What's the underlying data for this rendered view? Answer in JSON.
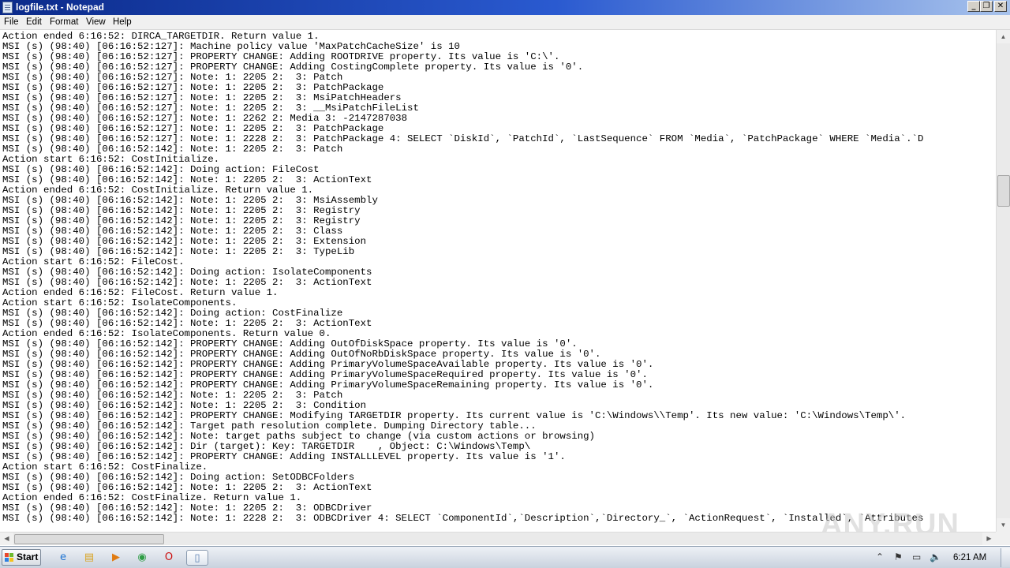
{
  "window": {
    "title": "logfile.txt - Notepad",
    "minimize_glyph": "_",
    "maximize_glyph": "❐",
    "close_glyph": "✕"
  },
  "menu": [
    "File",
    "Edit",
    "Format",
    "View",
    "Help"
  ],
  "lines": [
    "Action ended 6:16:52: DIRCA_TARGETDIR. Return value 1.",
    "MSI (s) (98:40) [06:16:52:127]: Machine policy value 'MaxPatchCacheSize' is 10",
    "MSI (s) (98:40) [06:16:52:127]: PROPERTY CHANGE: Adding ROOTDRIVE property. Its value is 'C:\\'.",
    "MSI (s) (98:40) [06:16:52:127]: PROPERTY CHANGE: Adding CostingComplete property. Its value is '0'.",
    "MSI (s) (98:40) [06:16:52:127]: Note: 1: 2205 2:  3: Patch",
    "MSI (s) (98:40) [06:16:52:127]: Note: 1: 2205 2:  3: PatchPackage",
    "MSI (s) (98:40) [06:16:52:127]: Note: 1: 2205 2:  3: MsiPatchHeaders",
    "MSI (s) (98:40) [06:16:52:127]: Note: 1: 2205 2:  3: __MsiPatchFileList",
    "MSI (s) (98:40) [06:16:52:127]: Note: 1: 2262 2: Media 3: -2147287038",
    "MSI (s) (98:40) [06:16:52:127]: Note: 1: 2205 2:  3: PatchPackage",
    "MSI (s) (98:40) [06:16:52:127]: Note: 1: 2228 2:  3: PatchPackage 4: SELECT `DiskId`, `PatchId`, `LastSequence` FROM `Media`, `PatchPackage` WHERE `Media`.`D",
    "MSI (s) (98:40) [06:16:52:142]: Note: 1: 2205 2:  3: Patch",
    "Action start 6:16:52: CostInitialize.",
    "MSI (s) (98:40) [06:16:52:142]: Doing action: FileCost",
    "MSI (s) (98:40) [06:16:52:142]: Note: 1: 2205 2:  3: ActionText",
    "Action ended 6:16:52: CostInitialize. Return value 1.",
    "MSI (s) (98:40) [06:16:52:142]: Note: 1: 2205 2:  3: MsiAssembly",
    "MSI (s) (98:40) [06:16:52:142]: Note: 1: 2205 2:  3: Registry",
    "MSI (s) (98:40) [06:16:52:142]: Note: 1: 2205 2:  3: Registry",
    "MSI (s) (98:40) [06:16:52:142]: Note: 1: 2205 2:  3: Class",
    "MSI (s) (98:40) [06:16:52:142]: Note: 1: 2205 2:  3: Extension",
    "MSI (s) (98:40) [06:16:52:142]: Note: 1: 2205 2:  3: TypeLib",
    "Action start 6:16:52: FileCost.",
    "MSI (s) (98:40) [06:16:52:142]: Doing action: IsolateComponents",
    "MSI (s) (98:40) [06:16:52:142]: Note: 1: 2205 2:  3: ActionText",
    "Action ended 6:16:52: FileCost. Return value 1.",
    "Action start 6:16:52: IsolateComponents.",
    "MSI (s) (98:40) [06:16:52:142]: Doing action: CostFinalize",
    "MSI (s) (98:40) [06:16:52:142]: Note: 1: 2205 2:  3: ActionText",
    "Action ended 6:16:52: IsolateComponents. Return value 0.",
    "MSI (s) (98:40) [06:16:52:142]: PROPERTY CHANGE: Adding OutOfDiskSpace property. Its value is '0'.",
    "MSI (s) (98:40) [06:16:52:142]: PROPERTY CHANGE: Adding OutOfNoRbDiskSpace property. Its value is '0'.",
    "MSI (s) (98:40) [06:16:52:142]: PROPERTY CHANGE: Adding PrimaryVolumeSpaceAvailable property. Its value is '0'.",
    "MSI (s) (98:40) [06:16:52:142]: PROPERTY CHANGE: Adding PrimaryVolumeSpaceRequired property. Its value is '0'.",
    "MSI (s) (98:40) [06:16:52:142]: PROPERTY CHANGE: Adding PrimaryVolumeSpaceRemaining property. Its value is '0'.",
    "MSI (s) (98:40) [06:16:52:142]: Note: 1: 2205 2:  3: Patch",
    "MSI (s) (98:40) [06:16:52:142]: Note: 1: 2205 2:  3: Condition",
    "MSI (s) (98:40) [06:16:52:142]: PROPERTY CHANGE: Modifying TARGETDIR property. Its current value is 'C:\\Windows\\\\Temp'. Its new value: 'C:\\Windows\\Temp\\'.",
    "MSI (s) (98:40) [06:16:52:142]: Target path resolution complete. Dumping Directory table...",
    "MSI (s) (98:40) [06:16:52:142]: Note: target paths subject to change (via custom actions or browsing)",
    "MSI (s) (98:40) [06:16:52:142]: Dir (target): Key: TARGETDIR    , Object: C:\\Windows\\Temp\\",
    "MSI (s) (98:40) [06:16:52:142]: PROPERTY CHANGE: Adding INSTALLLEVEL property. Its value is '1'.",
    "Action start 6:16:52: CostFinalize.",
    "MSI (s) (98:40) [06:16:52:142]: Doing action: SetODBCFolders",
    "MSI (s) (98:40) [06:16:52:142]: Note: 1: 2205 2:  3: ActionText",
    "Action ended 6:16:52: CostFinalize. Return value 1.",
    "MSI (s) (98:40) [06:16:52:142]: Note: 1: 2205 2:  3: ODBCDriver",
    "MSI (s) (98:40) [06:16:52:142]: Note: 1: 2228 2:  3: ODBCDriver 4: SELECT `ComponentId`,`Description`,`Directory_`, `ActionRequest`, `Installed`, `Attributes"
  ],
  "scrollbar": {
    "up": "▲",
    "down": "▼",
    "left": "◀",
    "right": "▶"
  },
  "watermark": "ANY.RUN",
  "taskbar": {
    "start_label": "Start",
    "items": [
      {
        "name": "ie-icon",
        "glyph": "e",
        "color": "#1e73d2"
      },
      {
        "name": "explorer-icon",
        "glyph": "▤",
        "color": "#d9a425"
      },
      {
        "name": "media-player-icon",
        "glyph": "▶",
        "color": "#e07b12"
      },
      {
        "name": "chrome-icon",
        "glyph": "◉",
        "color": "#2f9d45"
      },
      {
        "name": "opera-icon",
        "glyph": "O",
        "color": "#cc1111"
      },
      {
        "name": "notepad-icon",
        "glyph": "▯",
        "color": "#5a7fb0"
      }
    ],
    "tray": {
      "chevron": "⌃",
      "flag": "⚑",
      "monitor": "▭",
      "volume": "🔈"
    },
    "clock": "6:21 AM"
  }
}
